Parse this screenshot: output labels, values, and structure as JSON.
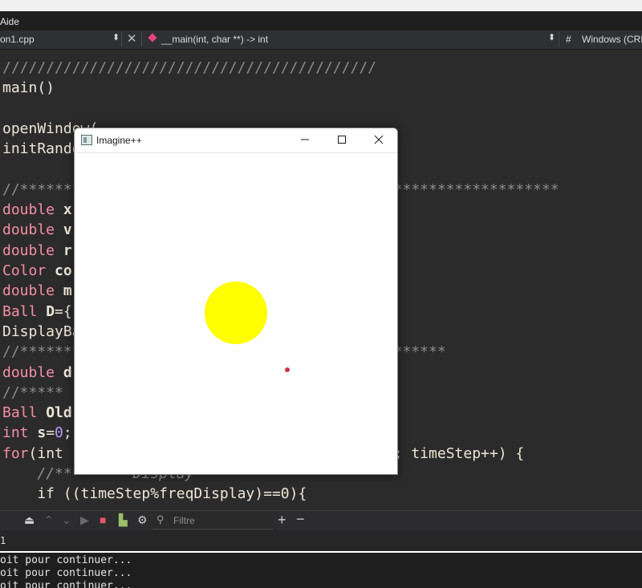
{
  "menubar": {
    "help": "Aide"
  },
  "navbar": {
    "file": "on1.cpp",
    "function": "__main(int, char **) -> int",
    "hash": "#",
    "line_ending": "Windows (CRL"
  },
  "editor": {
    "lines": [
      {
        "segments": [
          {
            "t": "///////////////////////////////////////////",
            "c": "c-comment"
          }
        ]
      },
      {
        "segments": [
          {
            "t": "main()",
            "c": "c-txt"
          }
        ]
      },
      {
        "segments": []
      },
      {
        "segments": [
          {
            "t": "openWindow(",
            "c": "c-txt"
          }
        ]
      },
      {
        "segments": [
          {
            "t": "initRandom",
            "c": "c-txt"
          }
        ]
      },
      {
        "segments": []
      },
      {
        "segments": [
          {
            "t": "//**************************************************************",
            "c": "c-comment"
          }
        ]
      },
      {
        "segments": [
          {
            "t": "double ",
            "c": "c-kw"
          },
          {
            "t": "x",
            "c": "c-txt b"
          }
        ]
      },
      {
        "segments": [
          {
            "t": "double ",
            "c": "c-kw"
          },
          {
            "t": "v",
            "c": "c-txt b"
          }
        ]
      },
      {
        "segments": [
          {
            "t": "double ",
            "c": "c-kw"
          },
          {
            "t": "r",
            "c": "c-txt b"
          }
        ]
      },
      {
        "segments": [
          {
            "t": "Color ",
            "c": "c-kw"
          },
          {
            "t": "co",
            "c": "c-txt b"
          }
        ]
      },
      {
        "segments": [
          {
            "t": "double ",
            "c": "c-kw"
          },
          {
            "t": "m",
            "c": "c-txt b"
          }
        ]
      },
      {
        "segments": [
          {
            "t": "Ball ",
            "c": "c-kw"
          },
          {
            "t": "D",
            "c": "c-txt b"
          },
          {
            "t": "={",
            "c": "c-txt"
          }
        ]
      },
      {
        "segments": [
          {
            "t": "DisplayBa",
            "c": "c-txt"
          }
        ]
      },
      {
        "segments": [
          {
            "t": "//*************************************************",
            "c": "c-comment"
          }
        ]
      },
      {
        "segments": [
          {
            "t": "double ",
            "c": "c-kw"
          },
          {
            "t": "d",
            "c": "c-txt b"
          }
        ]
      },
      {
        "segments": [
          {
            "t": "//*****",
            "c": "c-comment"
          }
        ]
      },
      {
        "segments": [
          {
            "t": "Ball ",
            "c": "c-kw"
          },
          {
            "t": "Old",
            "c": "c-txt b"
          }
        ]
      },
      {
        "segments": [
          {
            "t": "int ",
            "c": "c-kw"
          },
          {
            "t": "s",
            "c": "c-txt b"
          },
          {
            "t": "=",
            "c": "c-txt"
          },
          {
            "t": "0",
            "c": "c-num"
          },
          {
            "t": ";",
            "c": "c-txt"
          }
        ]
      },
      {
        "segments": [
          {
            "t": "for",
            "c": "c-kw"
          },
          {
            "t": "(int                                  play; timeStep++) {",
            "c": "c-txt"
          }
        ]
      },
      {
        "segments": [
          {
            "t": "    //******** Display ************",
            "c": "c-ital"
          }
        ]
      },
      {
        "segments": [
          {
            "t": "    if ((timeStep%freqDisplay)==0){",
            "c": "c-txt"
          }
        ]
      }
    ]
  },
  "toolbar": {
    "filter_placeholder": "Filtre"
  },
  "tab": {
    "label": "1"
  },
  "output": {
    "lines": [
      "oit pour continuer...",
      "oit pour continuer...",
      "oit pour continuer..."
    ]
  },
  "window": {
    "title": "Imagine++",
    "ball_color": "#ffff00",
    "dot_color": "#c8374a"
  }
}
